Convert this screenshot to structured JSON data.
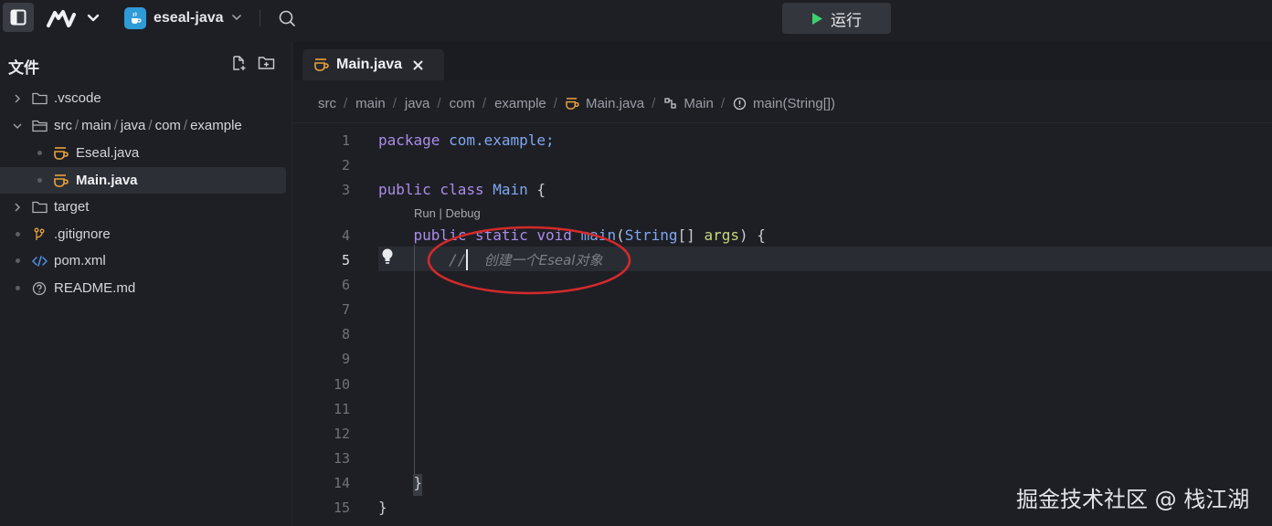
{
  "topbar": {
    "project_name": "eseal-java",
    "run_label": "运行"
  },
  "sidebar": {
    "title": "文件",
    "items": [
      {
        "label": ".vscode",
        "type": "folder",
        "expanded": false
      },
      {
        "label_parts": [
          "src",
          "main",
          "java",
          "com",
          "example"
        ],
        "type": "folder",
        "expanded": true
      },
      {
        "label": "Eseal.java",
        "type": "java"
      },
      {
        "label": "Main.java",
        "type": "java",
        "selected": true
      },
      {
        "label": "target",
        "type": "folder",
        "expanded": false
      },
      {
        "label": ".gitignore",
        "type": "git"
      },
      {
        "label": "pom.xml",
        "type": "xml"
      },
      {
        "label": "README.md",
        "type": "readme"
      }
    ]
  },
  "editor": {
    "tab_label": "Main.java",
    "breadcrumb": [
      "src",
      "main",
      "java",
      "com",
      "example",
      "Main.java",
      "Main",
      "main(String[])"
    ],
    "codelens": "Run | Debug",
    "line_numbers": [
      "1",
      "2",
      "3",
      "4",
      "5",
      "6",
      "7",
      "8",
      "9",
      "10",
      "11",
      "12",
      "13",
      "14",
      "15"
    ],
    "code": {
      "l1": [
        "package",
        " com.example;"
      ],
      "l3": [
        "public",
        " class",
        " Main",
        " {"
      ],
      "l4": [
        "public",
        " static",
        " void",
        " main",
        "(",
        "String",
        "[] ",
        "args",
        ") {"
      ],
      "l5_comment": "//",
      "l5_ghost": "创建一个Eseal对象",
      "l14": "}",
      "l15": "}"
    }
  },
  "colors": {
    "keyword": "#a98ce8",
    "type": "#7fa7ef",
    "param": "#c7d77a",
    "comment": "#7c7f86",
    "run_green": "#3ecf6e",
    "annotation_red": "#d42a2a",
    "java_icon": "#e8a23c"
  },
  "watermark": "掘金技术社区 @ 栈江湖"
}
